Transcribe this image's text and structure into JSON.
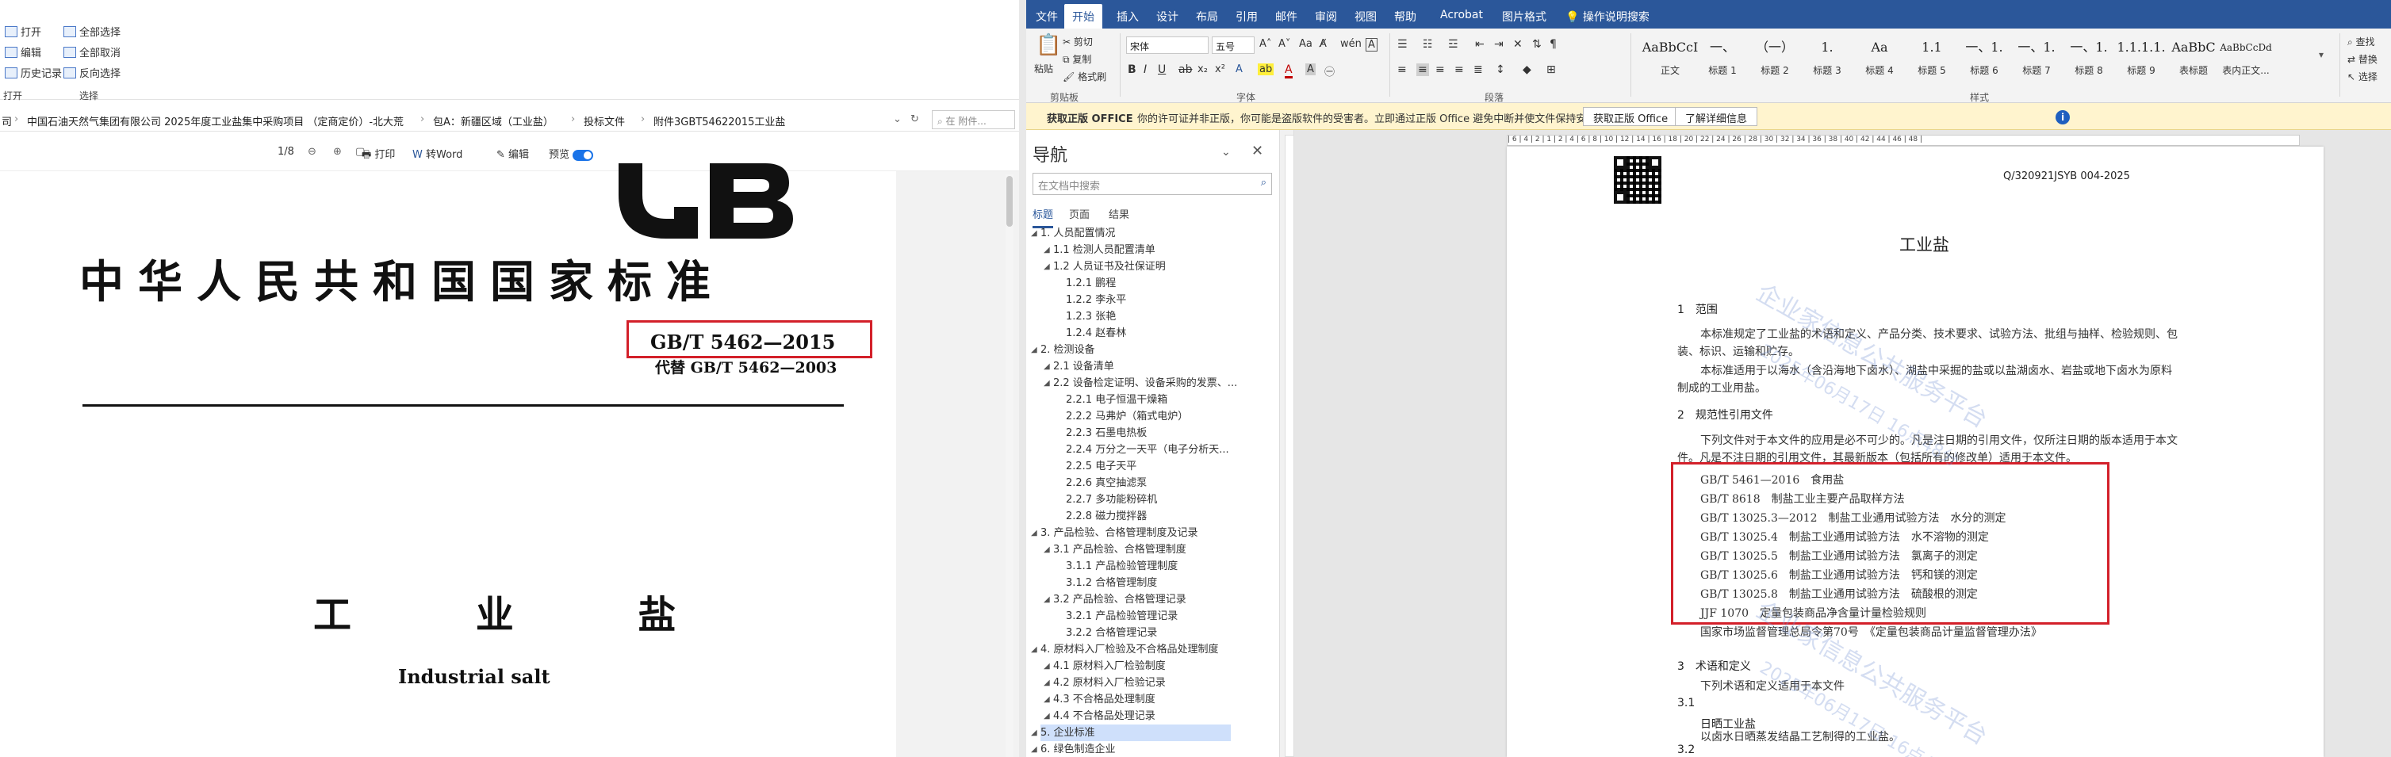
{
  "explorer": {
    "ribbon_items": [
      "打开",
      "编辑",
      "历史记录",
      "全部选择",
      "全部取消",
      "反向选择"
    ],
    "groups": [
      "打开",
      "选择"
    ],
    "breadcrumbs": [
      "司",
      "中国石油天然气集团有限公司 2025年度工业盐集中采购项目 （定商定价）-北大荒",
      "包A：新疆区域（工业盐）",
      "投标文件",
      "附件3GBT54622015工业盐"
    ],
    "search_placeholder": "在 附件..."
  },
  "pdf": {
    "page_indicator": "1/8",
    "print_label": "打印",
    "to_word_label": "转Word",
    "edit_label": "编辑",
    "preview_label": "预览",
    "title": "中华人民共和国国家标准",
    "standard_number": "GB/T 5462—2015",
    "replaces": "代替 GB/T 5462—2003",
    "cn_name": "工 业 盐",
    "en_name": "Industrial salt"
  },
  "word": {
    "tabs": [
      "文件",
      "开始",
      "插入",
      "设计",
      "布局",
      "引用",
      "邮件",
      "审阅",
      "视图",
      "帮助",
      "Acrobat",
      "图片格式",
      "操作说明搜索"
    ],
    "active_tab": "开始",
    "clipboard": {
      "paste": "粘贴",
      "cut": "剪切",
      "copy": "复制",
      "format_painter": "格式刷",
      "group": "剪贴板"
    },
    "font": {
      "name": "宋体",
      "size": "五号",
      "group": "字体"
    },
    "paragraph_group": "段落",
    "styles_group": "样式",
    "styles": [
      {
        "preview": "AaBbCcI",
        "name": "正文"
      },
      {
        "preview": "一、",
        "name": "标题 1"
      },
      {
        "preview": "（一）",
        "name": "标题 2"
      },
      {
        "preview": "1.",
        "name": "标题 3"
      },
      {
        "preview": "Aa",
        "name": "标题 4"
      },
      {
        "preview": "1.1",
        "name": "标题 5"
      },
      {
        "preview": "一、1.",
        "name": "标题 6"
      },
      {
        "preview": "一、1.",
        "name": "标题 7"
      },
      {
        "preview": "一、1.",
        "name": "标题 8"
      },
      {
        "preview": "1.1.1.1.",
        "name": "标题 9"
      },
      {
        "preview": "AaBbC",
        "name": "表标题"
      },
      {
        "preview": "AaBbCcDd",
        "name": "表内正文..."
      }
    ],
    "right_edge": [
      "查找",
      "替换",
      "选择"
    ],
    "message": {
      "label": "获取正版 OFFICE",
      "text": "你的许可证并非正版，你可能是盗版软件的受害者。立即通过正版 Office 避免中断并使文件保持安全。",
      "btn1": "获取正版 Office",
      "btn2": "了解详细信息"
    },
    "nav": {
      "title": "导航",
      "search_placeholder": "在文档中搜索",
      "tabs": [
        "标题",
        "页面",
        "结果"
      ],
      "items": [
        {
          "t": "1. 人员配置情况",
          "lvl": 1
        },
        {
          "t": "1.1 检测人员配置清单",
          "lvl": 2
        },
        {
          "t": "1.2 人员证书及社保证明",
          "lvl": 2
        },
        {
          "t": "1.2.1 鹏程",
          "lvl": 3
        },
        {
          "t": "1.2.2 李永平",
          "lvl": 3
        },
        {
          "t": "1.2.3 张艳",
          "lvl": 3
        },
        {
          "t": "1.2.4 赵春林",
          "lvl": 3
        },
        {
          "t": "2. 检测设备",
          "lvl": 1
        },
        {
          "t": "2.1 设备清单",
          "lvl": 2
        },
        {
          "t": "2.2 设备检定证明、设备采购的发票、...",
          "lvl": 2
        },
        {
          "t": "2.2.1 电子恒温干燥箱",
          "lvl": 3
        },
        {
          "t": "2.2.2 马弗炉（箱式电炉）",
          "lvl": 3
        },
        {
          "t": "2.2.3 石墨电热板",
          "lvl": 3
        },
        {
          "t": "2.2.4 万分之一天平（电子分析天...",
          "lvl": 3
        },
        {
          "t": "2.2.5 电子天平",
          "lvl": 3
        },
        {
          "t": "2.2.6 真空抽滤泵",
          "lvl": 3
        },
        {
          "t": "2.2.7 多功能粉碎机",
          "lvl": 3
        },
        {
          "t": "2.2.8 磁力搅拌器",
          "lvl": 3
        },
        {
          "t": "3. 产品检验、合格管理制度及记录",
          "lvl": 1
        },
        {
          "t": "3.1 产品检验、合格管理制度",
          "lvl": 2
        },
        {
          "t": "3.1.1 产品检验管理制度",
          "lvl": 3
        },
        {
          "t": "3.1.2 合格管理制度",
          "lvl": 3
        },
        {
          "t": "3.2 产品检验、合格管理记录",
          "lvl": 2
        },
        {
          "t": "3.2.1 产品检验管理记录",
          "lvl": 3
        },
        {
          "t": "3.2.2 合格管理记录",
          "lvl": 3
        },
        {
          "t": "4. 原材料入厂检验及不合格品处理制度",
          "lvl": 1
        },
        {
          "t": "4.1 原材料入厂检验制度",
          "lvl": 2
        },
        {
          "t": "4.2 原材料入厂检验记录",
          "lvl": 2
        },
        {
          "t": "4.3 不合格品处理制度",
          "lvl": 2
        },
        {
          "t": "4.4 不合格品处理记录",
          "lvl": 2
        },
        {
          "t": "5. 企业标准",
          "lvl": 1,
          "sel": true
        },
        {
          "t": "6. 绿色制造企业",
          "lvl": 1
        }
      ]
    },
    "doc": {
      "code": "Q/320921JSYB 004-2025",
      "title": "工业盐",
      "s1_heading": "1　范围",
      "s1_p1a": "本标准规定了工业盐的术语和定义、产品分类、技术要求、试验方法、批组与抽样、检验规则、包",
      "s1_p1b": "装、标识、运输和贮存。",
      "s1_p2a": "本标准适用于以海水（含沿海地下卤水）、湖盐中采掘的盐或以盐湖卤水、岩盐或地下卤水为原料",
      "s1_p2b": "制成的工业用盐。",
      "s2_heading": "2　规范性引用文件",
      "s2_p1a": "下列文件对于本文件的应用是必不可少的。凡是注日期的引用文件，仅所注日期的版本适用于本文",
      "s2_p1b": "件。凡是不注日期的引用文件，其最新版本（包括所有的修改单）适用于本文件。",
      "refs": [
        "GB/T 5461—2016　食用盐",
        "GB/T 8618　制盐工业主要产品取样方法",
        "GB/T 13025.3—2012　制盐工业通用试验方法　水分的测定",
        "GB/T 13025.4　制盐工业通用试验方法　水不溶物的测定",
        "GB/T 13025.5　制盐工业通用试验方法　氯离子的测定",
        "GB/T 13025.6　制盐工业通用试验方法　钙和镁的测定",
        "GB/T 13025.8　制盐工业通用试验方法　硫酸根的测定",
        "JJF 1070　定量包装商品净含量计量检验规则"
      ],
      "ref_tail": "国家市场监督管理总局令第70号　《定量包装商品计量监督管理办法》",
      "s3_heading": "3　术语和定义",
      "s3_p1": "下列术语和定义适用于本文件",
      "s31": "3.1",
      "s31_term": "日晒工业盐",
      "s31_def": "以卤水日晒蒸发结晶工艺制得的工业盐。",
      "s32": "3.2",
      "watermarks": [
        "企业家信息公共服务平台",
        "2025年06月17日 16点48分",
        "企业家信息公共服务平台",
        "2025年06月17日 16点48分"
      ]
    }
  }
}
